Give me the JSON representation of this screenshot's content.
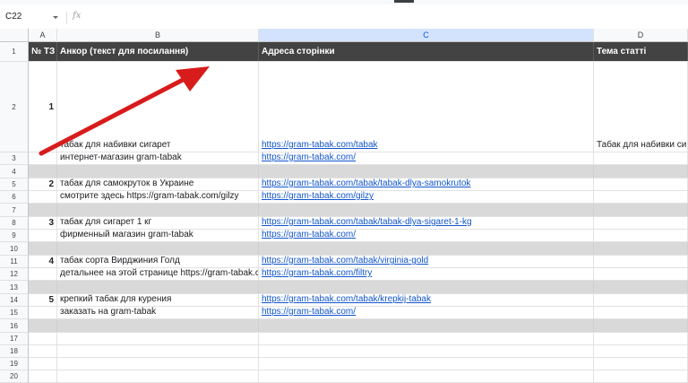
{
  "formula_bar": {
    "cell_ref": "C22",
    "fx_label": "fx",
    "value": ""
  },
  "columns": [
    {
      "letter": "A",
      "width": 32
    },
    {
      "letter": "B",
      "width": 225
    },
    {
      "letter": "C",
      "width": 374,
      "selected": true
    },
    {
      "letter": "D",
      "width": 105
    }
  ],
  "header_row": {
    "col_a": "№ ТЗ",
    "col_b": "Анкор (текст для посилання)",
    "col_c": "Адреса сторінки",
    "col_d": "Тема статті"
  },
  "rows": [
    {
      "num": "1",
      "type": "header",
      "h": 22
    },
    {
      "num": "2",
      "type": "data",
      "h": 101,
      "a": "1",
      "b": "табак для набивки сигарет",
      "c": "https://gram-tabak.com/tabak",
      "d": "Табак для набивки сигарет"
    },
    {
      "num": "3",
      "type": "data",
      "h": 14,
      "a": "",
      "b": "интернет-магазин gram-tabak",
      "c": "https://gram-tabak.com/",
      "d": ""
    },
    {
      "num": "4",
      "type": "gray",
      "h": 15
    },
    {
      "num": "5",
      "type": "data",
      "h": 14,
      "a": "2",
      "b": "табак для самокруток в Украине",
      "c": "https://gram-tabak.com/tabak/tabak-dlya-samokrutok",
      "d": ""
    },
    {
      "num": "6",
      "type": "data",
      "h": 14,
      "a": "",
      "b": "смотрите здесь https://gram-tabak.com/gilzy",
      "c": "https://gram-tabak.com/gilzy",
      "d": ""
    },
    {
      "num": "7",
      "type": "gray",
      "h": 15
    },
    {
      "num": "8",
      "type": "data",
      "h": 14,
      "a": "3",
      "b": "табак для сигарет 1 кг",
      "c": "https://gram-tabak.com/tabak/tabak-dlya-sigaret-1-kg",
      "d": ""
    },
    {
      "num": "9",
      "type": "data",
      "h": 14,
      "a": "",
      "b": "фирменный магазин gram-tabak",
      "c": "https://gram-tabak.com/",
      "d": ""
    },
    {
      "num": "10",
      "type": "gray",
      "h": 15
    },
    {
      "num": "11",
      "type": "data",
      "h": 14,
      "a": "4",
      "b": "табак сорта Вирджиния Голд",
      "c": "https://gram-tabak.com/tabak/virginia-gold",
      "d": ""
    },
    {
      "num": "12",
      "type": "data",
      "h": 14,
      "a": "",
      "b": "детальнее на этой странице https://gram-tabak.com/fi",
      "c": "https://gram-tabak.com/filtry",
      "d": ""
    },
    {
      "num": "13",
      "type": "gray",
      "h": 15
    },
    {
      "num": "14",
      "type": "data",
      "h": 14,
      "a": "5",
      "b": "крепкий табак для курения",
      "c": "https://gram-tabak.com/tabak/krepkij-tabak",
      "d": ""
    },
    {
      "num": "15",
      "type": "data",
      "h": 14,
      "a": "",
      "b": "заказать на gram-tabak",
      "c": "https://gram-tabak.com/",
      "d": ""
    },
    {
      "num": "16",
      "type": "gray",
      "h": 15
    },
    {
      "num": "17",
      "type": "empty",
      "h": 14
    },
    {
      "num": "18",
      "type": "empty",
      "h": 14
    },
    {
      "num": "19",
      "type": "empty",
      "h": 14
    },
    {
      "num": "20",
      "type": "empty",
      "h": 14
    }
  ],
  "annotation": {
    "type": "arrow",
    "color": "#d81b1b"
  }
}
